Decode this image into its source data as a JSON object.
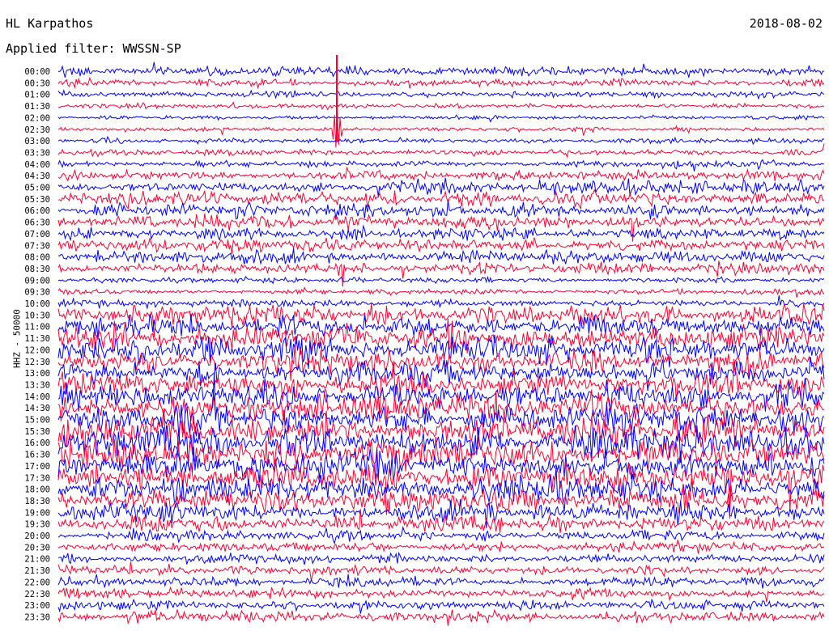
{
  "header": {
    "station": "HL Karpathos",
    "date": "2018-08-02",
    "filter": "Applied filter: WWSSN-SP",
    "channel_label": "HHZ - 50000"
  },
  "colors": {
    "trace_a": "#0000ff",
    "trace_b": "#ff0033",
    "background": "#ffffff"
  },
  "chart_data": {
    "type": "line",
    "subtype": "helicorder",
    "title": "HL Karpathos",
    "ylabel": "HHZ - 50000",
    "row_labels": [
      "00:00",
      "00:30",
      "01:00",
      "01:30",
      "02:00",
      "02:30",
      "03:00",
      "03:30",
      "04:00",
      "04:30",
      "05:00",
      "05:30",
      "06:00",
      "06:30",
      "07:00",
      "07:30",
      "08:00",
      "08:30",
      "09:00",
      "09:30",
      "10:00",
      "10:30",
      "11:00",
      "11:30",
      "12:00",
      "12:30",
      "13:00",
      "13:30",
      "14:00",
      "14:30",
      "15:00",
      "15:30",
      "16:00",
      "16:30",
      "17:00",
      "17:30",
      "18:00",
      "18:30",
      "19:00",
      "19:30",
      "20:00",
      "20:30",
      "21:00",
      "21:30",
      "22:00",
      "22:30",
      "23:00",
      "23:30"
    ],
    "row_colors": [
      "blue",
      "red"
    ],
    "relative_amplitude": [
      1.6,
      1.4,
      1.3,
      1.0,
      0.8,
      0.9,
      1.0,
      1.1,
      1.3,
      1.9,
      2.6,
      2.8,
      2.8,
      2.5,
      2.3,
      2.4,
      2.7,
      2.3,
      1.0,
      1.1,
      1.3,
      4.0,
      4.2,
      4.6,
      4.8,
      4.5,
      4.7,
      4.8,
      5.0,
      5.2,
      5.6,
      5.8,
      5.6,
      5.7,
      5.6,
      5.4,
      5.2,
      4.8,
      3.8,
      3.0,
      1.9,
      1.8,
      1.8,
      1.8,
      1.8,
      1.9,
      2.0,
      2.1
    ],
    "events": [
      {
        "row": "02:30",
        "note": "spike"
      }
    ],
    "grid": false
  }
}
